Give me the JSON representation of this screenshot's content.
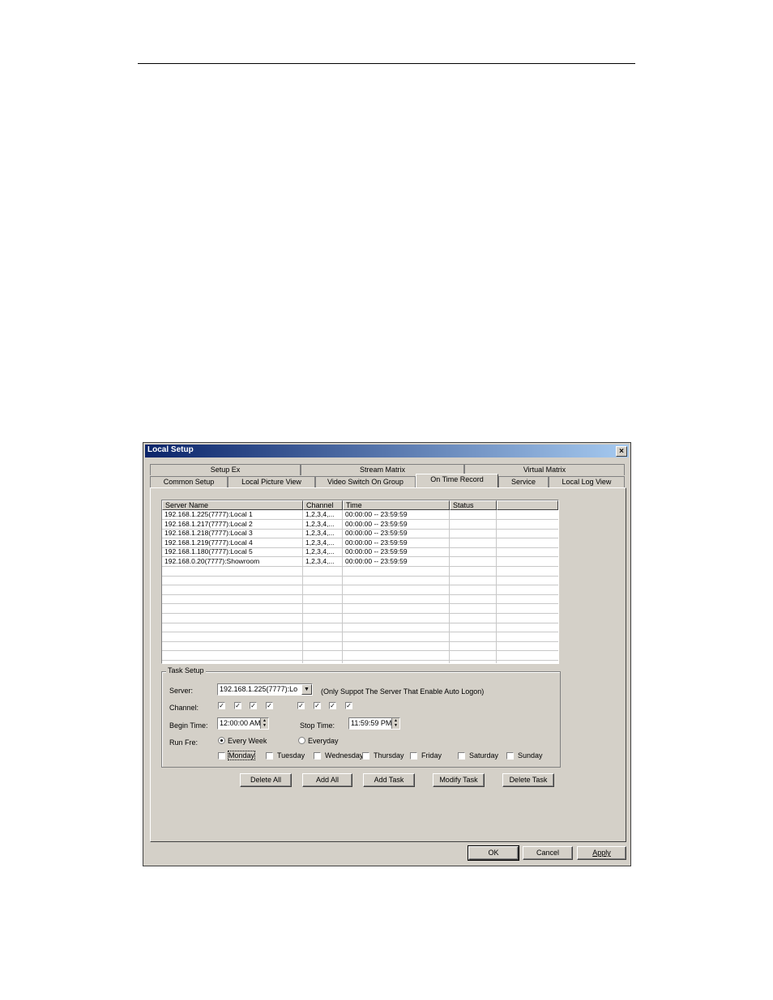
{
  "window": {
    "title": "Local Setup",
    "close_label": "×"
  },
  "tabs_top": [
    "Setup Ex",
    "Stream Matrix",
    "Virtual Matrix"
  ],
  "tabs_bottom": [
    "Common Setup",
    "Local Picture View",
    "Video Switch On Group",
    "On Time Record",
    "Service",
    "Local Log View"
  ],
  "active_tab": "On Time Record",
  "list": {
    "columns": [
      "Server Name",
      "Channel",
      "Time",
      "Status",
      ""
    ],
    "rows": [
      [
        "192.168.1.225(7777):Local 1",
        "1,2,3,4,...",
        "00:00:00 -- 23:59:59",
        ""
      ],
      [
        "192.168.1.217(7777):Local 2",
        "1,2,3,4,...",
        "00:00:00 -- 23:59:59",
        ""
      ],
      [
        "192.168.1.218(7777):Local 3",
        "1,2,3,4,...",
        "00:00:00 -- 23:59:59",
        ""
      ],
      [
        "192.168.1.219(7777):Local 4",
        "1,2,3,4,...",
        "00:00:00 -- 23:59:59",
        ""
      ],
      [
        "192.168.1.180(7777):Local 5",
        "1,2,3,4,...",
        "00:00:00 -- 23:59:59",
        ""
      ],
      [
        "192.168.0.20(7777):Showroom",
        "1,2,3,4,...",
        "00:00:00 -- 23:59:59",
        ""
      ]
    ]
  },
  "task_setup": {
    "title": "Task Setup",
    "server_label": "Server:",
    "server_value": "192.168.1.225(7777):Lo",
    "server_note": "(Only Suppot The Server That Enable Auto Logon)",
    "channel_label": "Channel:",
    "channels_checked": [
      true,
      true,
      true,
      true,
      true,
      true,
      true,
      true
    ],
    "begin_label": "Begin Time:",
    "begin_value": "12:00:00 AM",
    "stop_label": "Stop Time:",
    "stop_value": "11:59:59 PM",
    "runfre_label": "Run Fre:",
    "every_week": "Every Week",
    "everyday": "Everyday",
    "days": [
      "Monday",
      "Tuesday",
      "Wednesday",
      "Thursday",
      "Friday",
      "Saturday",
      "Sunday"
    ]
  },
  "buttons": {
    "delete_all": "Delete All",
    "add_all": "Add All",
    "add_task": "Add Task",
    "modify_task": "Modify Task",
    "delete_task": "Delete Task",
    "ok": "OK",
    "cancel": "Cancel",
    "apply": "Apply"
  }
}
